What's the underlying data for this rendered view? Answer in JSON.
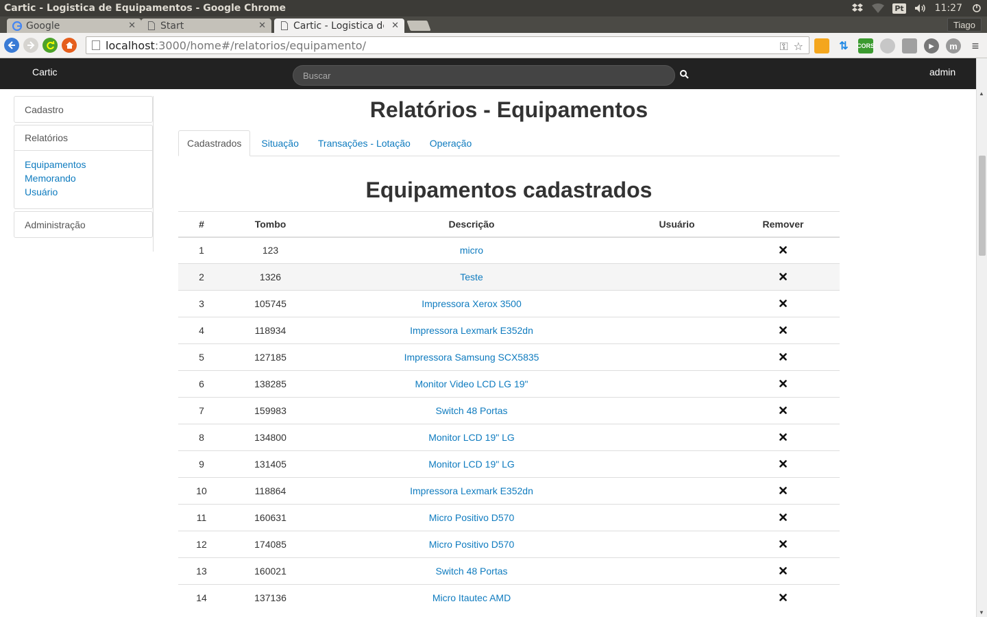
{
  "os": {
    "window_title": "Cartic - Logistica de Equipamentos - Google Chrome",
    "lang": "Pt",
    "clock": "11:27"
  },
  "browser": {
    "tabs": [
      {
        "label": "Google",
        "active": false
      },
      {
        "label": "Start",
        "active": false
      },
      {
        "label": "Cartic - Logistica de Equipamentos",
        "active": true
      }
    ],
    "profile": "Tiago",
    "url_host": "localhost",
    "url_rest": ":3000/home#/relatorios/equipamento/"
  },
  "navbar": {
    "brand": "Cartic",
    "search_placeholder": "Buscar",
    "user": "admin"
  },
  "sidebar": {
    "panels": [
      {
        "label": "Cadastro"
      },
      {
        "label": "Relatórios",
        "links": [
          "Equipamentos",
          "Memorando",
          "Usuário"
        ]
      },
      {
        "label": "Administração"
      }
    ]
  },
  "main": {
    "title": "Relatórios - Equipamentos",
    "tabs": [
      "Cadastrados",
      "Situação",
      "Transações - Lotação",
      "Operação"
    ],
    "section_title": "Equipamentos cadastrados",
    "columns": [
      "#",
      "Tombo",
      "Descrição",
      "Usuário",
      "Remover"
    ],
    "rows": [
      {
        "num": "1",
        "tombo": "123",
        "desc": "micro",
        "user": ""
      },
      {
        "num": "2",
        "tombo": "1326",
        "desc": "Teste",
        "user": ""
      },
      {
        "num": "3",
        "tombo": "105745",
        "desc": "Impressora Xerox 3500",
        "user": ""
      },
      {
        "num": "4",
        "tombo": "118934",
        "desc": "Impressora Lexmark E352dn",
        "user": ""
      },
      {
        "num": "5",
        "tombo": "127185",
        "desc": "Impressora Samsung SCX5835",
        "user": ""
      },
      {
        "num": "6",
        "tombo": "138285",
        "desc": "Monitor Video LCD LG 19\"",
        "user": ""
      },
      {
        "num": "7",
        "tombo": "159983",
        "desc": "Switch 48 Portas",
        "user": ""
      },
      {
        "num": "8",
        "tombo": "134800",
        "desc": "Monitor LCD 19\" LG",
        "user": ""
      },
      {
        "num": "9",
        "tombo": "131405",
        "desc": "Monitor LCD 19\" LG",
        "user": ""
      },
      {
        "num": "10",
        "tombo": "118864",
        "desc": "Impressora Lexmark E352dn",
        "user": ""
      },
      {
        "num": "11",
        "tombo": "160631",
        "desc": "Micro Positivo D570",
        "user": ""
      },
      {
        "num": "12",
        "tombo": "174085",
        "desc": "Micro Positivo D570",
        "user": ""
      },
      {
        "num": "13",
        "tombo": "160021",
        "desc": "Switch 48 Portas",
        "user": ""
      },
      {
        "num": "14",
        "tombo": "137136",
        "desc": "Micro Itautec AMD",
        "user": ""
      }
    ]
  },
  "colors": {
    "link": "#0e7bbf",
    "navbar_bg": "#222222",
    "os_bar_bg": "#3c3b37"
  }
}
